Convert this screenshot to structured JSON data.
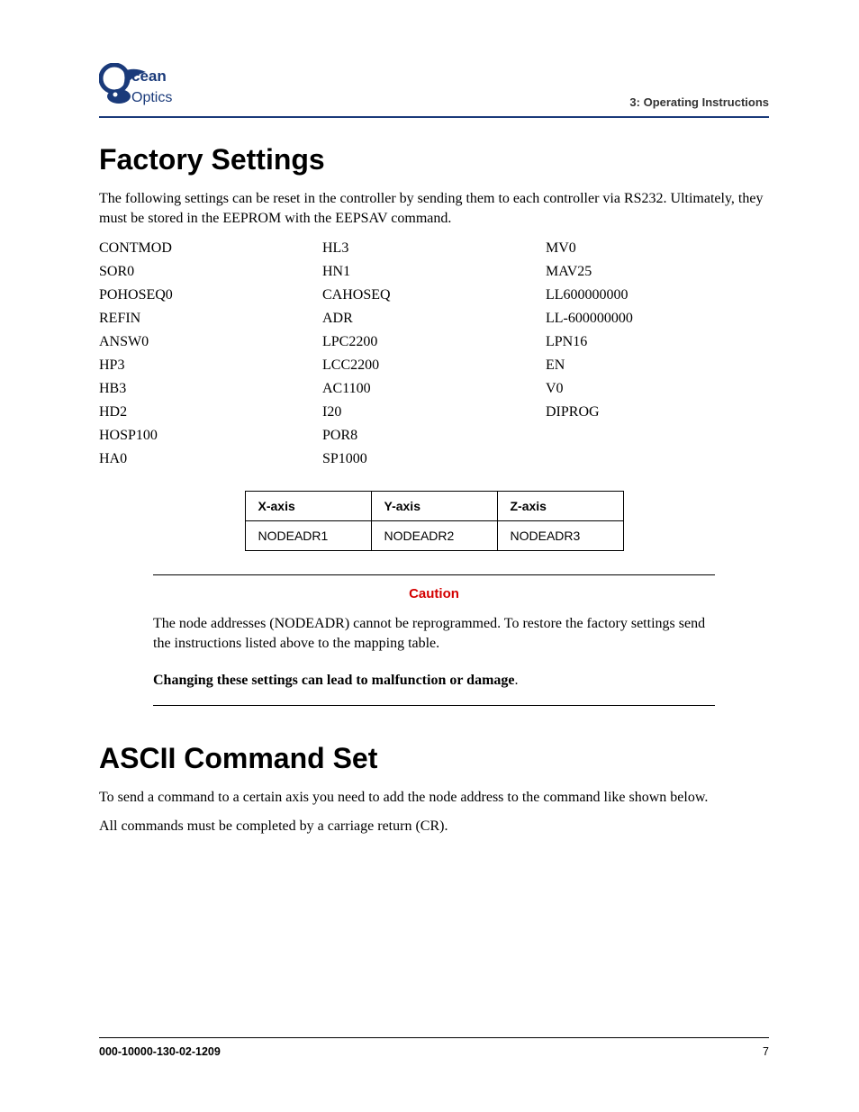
{
  "header": {
    "section_label": "3: Operating Instructions",
    "logo_top": "cean",
    "logo_bottom": "Optics"
  },
  "h1_a": "Factory Settings",
  "intro_a": "The following settings can be reset in the controller by sending them to each controller via RS232. Ultimately, they must be stored in the EEPROM with the EEPSAV command.",
  "settings": {
    "col1": [
      "CONTMOD",
      "SOR0",
      "POHOSEQ0",
      "REFIN",
      "ANSW0",
      "HP3",
      "HB3",
      "HD2",
      "HOSP100",
      "HA0"
    ],
    "col2": [
      "HL3",
      "HN1",
      "CAHOSEQ",
      "ADR",
      "LPC2200",
      "LCC2200",
      "AC1100",
      "I20",
      "POR8",
      "SP1000"
    ],
    "col3": [
      "MV0",
      "MAV25",
      "LL600000000",
      "LL-600000000",
      "LPN16",
      "EN",
      "V0",
      "DIPROG"
    ]
  },
  "axis_table": {
    "headers": [
      "X-axis",
      "Y-axis",
      "Z-axis"
    ],
    "row": [
      "NODEADR1",
      "NODEADR2",
      "NODEADR3"
    ]
  },
  "caution": {
    "title": "Caution",
    "text": "The node addresses (NODEADR) cannot be reprogrammed. To restore the factory settings send the instructions listed above to the mapping table.",
    "warn": "Changing these settings can lead to malfunction or damage",
    "warn_suffix": "."
  },
  "h1_b": "ASCII Command Set",
  "ascii_p1": "To send a command to a certain axis you need to add the node address to the command like shown below.",
  "ascii_p2": "All commands must be completed by a carriage return (CR).",
  "footer": {
    "docnum": "000-10000-130-02-1209",
    "pagenum": "7"
  }
}
